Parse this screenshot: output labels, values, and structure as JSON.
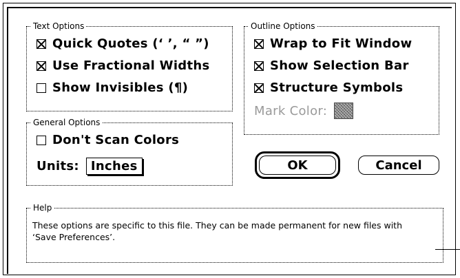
{
  "text_options": {
    "title": "Text Options",
    "items": [
      {
        "label": "Quick Quotes (‘ ’, “ ”)",
        "checked": true
      },
      {
        "label": "Use Fractional Widths",
        "checked": true
      },
      {
        "label": "Show Invisibles (¶)",
        "checked": false
      }
    ]
  },
  "outline_options": {
    "title": "Outline Options",
    "items": [
      {
        "label": "Wrap to Fit Window",
        "checked": true
      },
      {
        "label": "Show Selection Bar",
        "checked": true
      },
      {
        "label": "Structure Symbols",
        "checked": true
      }
    ],
    "mark_color_label": "Mark Color:"
  },
  "general_options": {
    "title": "General Options",
    "dont_scan_colors_label": "Don't Scan Colors",
    "dont_scan_colors_checked": false,
    "units_label": "Units:",
    "units_value": "Inches"
  },
  "buttons": {
    "ok_label": "OK",
    "cancel_label": "Cancel"
  },
  "help": {
    "title": "Help",
    "text": "These options are specific to this file.  They can be made permanent for new files with ‘Save Preferences’."
  }
}
